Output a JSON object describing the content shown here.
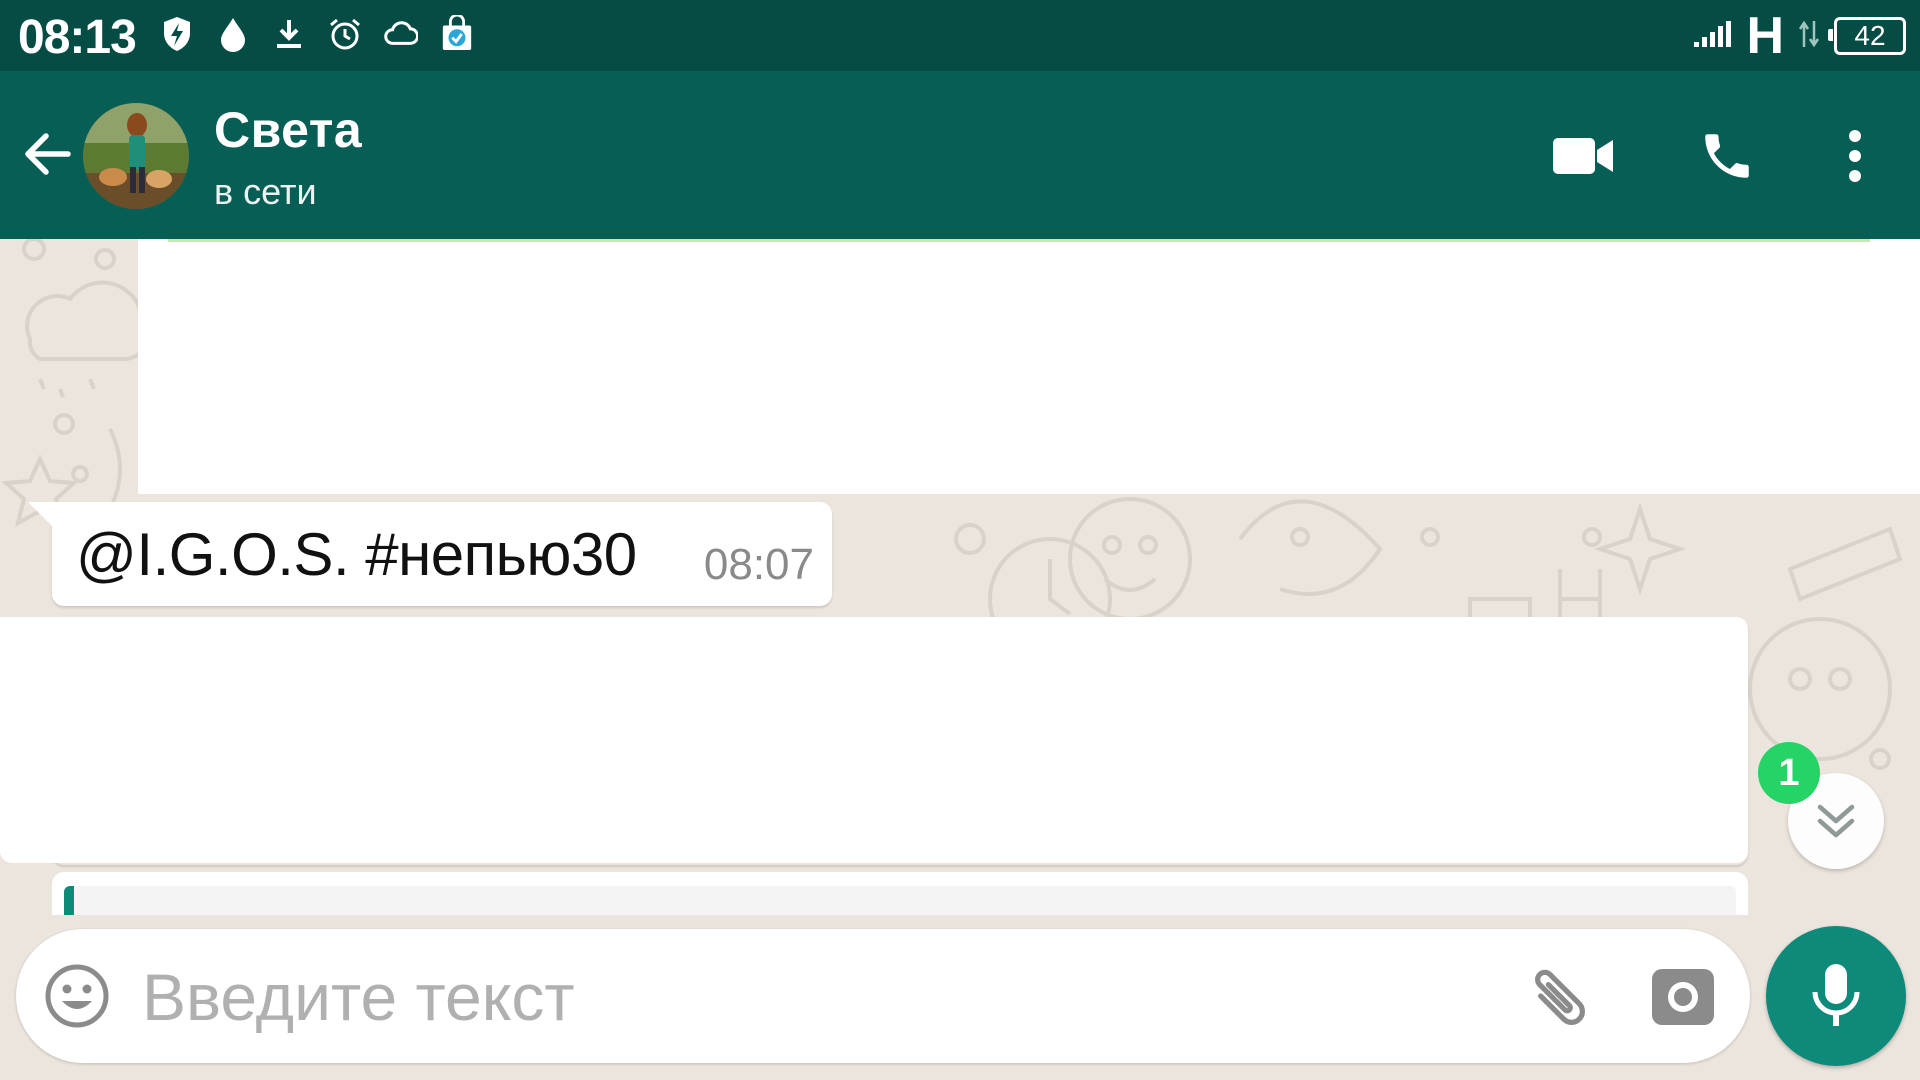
{
  "status_bar": {
    "time": "08:13",
    "network": "H",
    "battery": "42",
    "icons": [
      "shield-bolt-icon",
      "drop-icon",
      "download-icon",
      "alarm-icon",
      "cloud-icon",
      "shopping-bag-icon",
      "signal-icon",
      "data-arrows-icon"
    ]
  },
  "header": {
    "contact_name": "Света",
    "contact_status": "в сети",
    "colors": {
      "toolbar": "#075e54",
      "statusbar": "#054d44"
    }
  },
  "messages": [
    {
      "type": "incoming",
      "text": "@I.G.O.S. #непью30",
      "time": "08:07"
    }
  ],
  "scroll_button": {
    "unread_count": "1"
  },
  "composer": {
    "placeholder": "Введите текст",
    "value": ""
  },
  "accent_colors": {
    "fab": "#0e8a7a",
    "badge": "#25d366"
  }
}
